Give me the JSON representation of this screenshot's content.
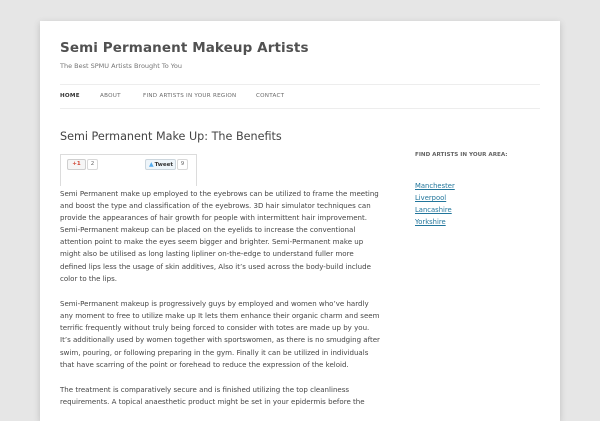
{
  "site": {
    "title": "Semi Permanent Makeup Artists",
    "description": "The Best SPMU Artists Brought To You"
  },
  "nav": {
    "items": [
      {
        "label": "HOME"
      },
      {
        "label": "ABOUT"
      },
      {
        "label": "FIND ARTISTS IN YOUR REGION"
      },
      {
        "label": "CONTACT"
      }
    ],
    "active": "HOME"
  },
  "post": {
    "title": "Semi Permanent Make Up: The Benefits",
    "share": {
      "gplus_label": "+1",
      "gplus_count": "2",
      "tweet_label": "Tweet",
      "tweet_count": "9"
    },
    "paragraphs": [
      "Semi Permanent make up employed to the eyebrows can be utilized to frame the meeting and boost the type and classification of the eyebrows. 3D hair simulator techniques can provide the appearances of hair growth for people with intermittent hair improvement. Semi-Permanent makeup can be placed on the eyelids to increase the conventional attention point to make the eyes seem bigger and brighter. Semi-Permanent make up might also be utilised as long lasting lipliner on-the-edge to understand fuller more defined lips less the usage of skin additives, Also it’s used across the body-build include color to the lips.",
      "Semi-Permanent makeup is progressively guys by employed and women who’ve hardly any moment to free to utilize make up It lets them enhance their organic charm and seem terrific frequently without truly being forced to consider with totes are made up by you. It’s additionally used by women together with sportswomen, as there is no smudging after swim, pouring, or following preparing in the gym. Finally it can be utilized in individuals that have scarring of the point or forehead to reduce the expression of the keloid.",
      "The treatment is comparatively secure and is finished utilizing the top cleanliness requirements. A topical anaesthetic product might be set in your epidermis before the"
    ]
  },
  "sidebar": {
    "widget_title": "FIND ARTISTS IN YOUR AREA:",
    "links": [
      {
        "label": "Manchester"
      },
      {
        "label": "Liverpool"
      },
      {
        "label": "Lancashire"
      },
      {
        "label": "Yorkshire"
      }
    ]
  },
  "colors": {
    "background": "#e6e6e6",
    "link": "#21759b",
    "text": "#444444"
  }
}
